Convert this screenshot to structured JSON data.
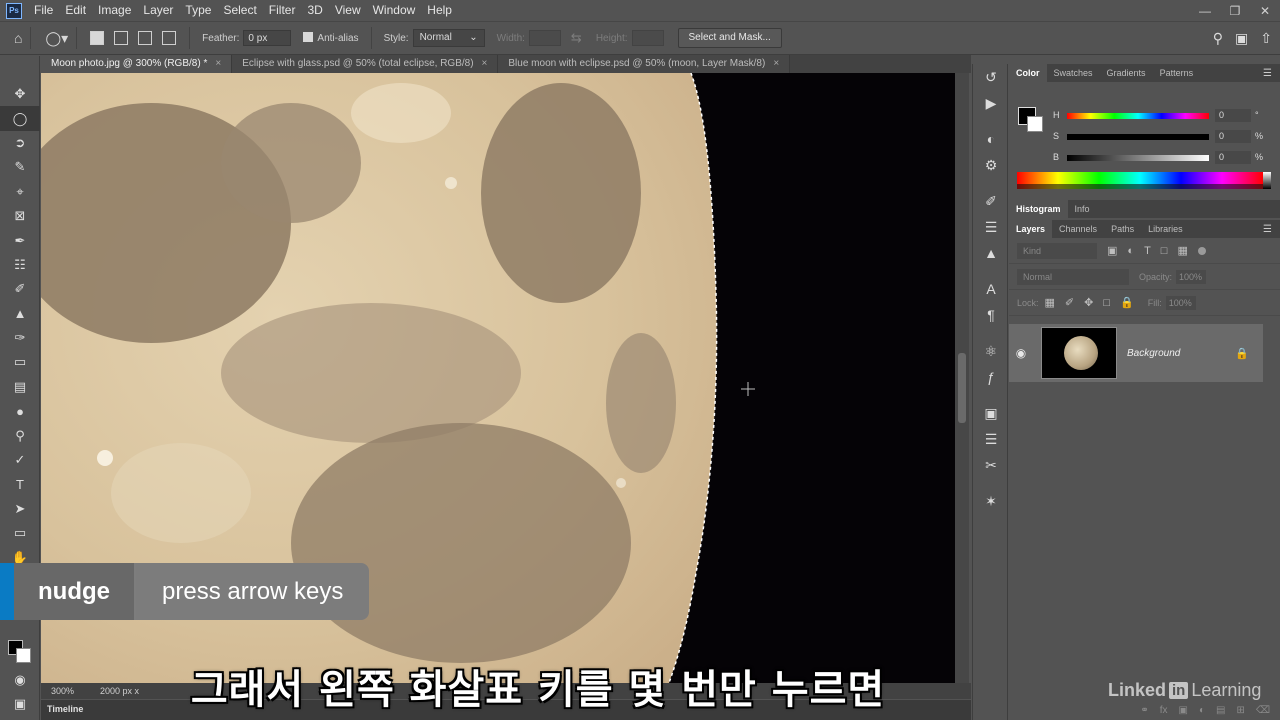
{
  "app": {
    "logo": "Ps"
  },
  "menu": [
    "File",
    "Edit",
    "Image",
    "Layer",
    "Type",
    "Select",
    "Filter",
    "3D",
    "View",
    "Window",
    "Help"
  ],
  "options_bar": {
    "feather_label": "Feather:",
    "feather_value": "0 px",
    "antialias_label": "Anti-alias",
    "style_label": "Style:",
    "style_value": "Normal",
    "width_label": "Width:",
    "height_label": "Height:",
    "select_mask_label": "Select and Mask..."
  },
  "tabs": [
    {
      "label": "Moon photo.jpg @ 300% (RGB/8) *",
      "active": true
    },
    {
      "label": "Eclipse with glass.psd @ 50% (total eclipse, RGB/8)",
      "active": false
    },
    {
      "label": "Blue moon with eclipse.psd @ 50% (moon, Layer Mask/8)",
      "active": false
    }
  ],
  "status": {
    "zoom": "300%",
    "doc": "2000 px x"
  },
  "timeline_label": "Timeline",
  "overlay": {
    "key": "nudge",
    "value": "press arrow keys"
  },
  "subtitle": "그래서 왼쪽 화살표 키를 몇 번만 누르면",
  "color_panel": {
    "tabs": [
      "Color",
      "Swatches",
      "Gradients",
      "Patterns"
    ],
    "h": {
      "label": "H",
      "value": "0",
      "unit": "°"
    },
    "s": {
      "label": "S",
      "value": "0",
      "unit": "%"
    },
    "b": {
      "label": "B",
      "value": "0",
      "unit": "%"
    }
  },
  "hist_tabs": [
    "Histogram",
    "Info"
  ],
  "layers_panel": {
    "tabs": [
      "Layers",
      "Channels",
      "Paths",
      "Libraries"
    ],
    "kind_placeholder": "Kind",
    "blend_mode": "Normal",
    "opacity_label": "Opacity:",
    "opacity_value": "100%",
    "lock_label": "Lock:",
    "fill_label": "Fill:",
    "fill_value": "100%",
    "layer_name": "Background"
  },
  "watermark": {
    "a": "Linked",
    "b": "in",
    "c": "Learning"
  }
}
